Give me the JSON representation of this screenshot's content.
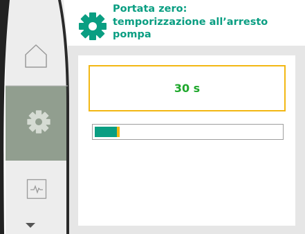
{
  "header": {
    "icon": "gear-icon",
    "title_lines": [
      "Portata zero:",
      "temporizzazione all’arresto",
      "pompa"
    ]
  },
  "value": {
    "display": "30 s",
    "fraction": 0.12
  },
  "sidebar": {
    "items": [
      {
        "icon": "home-icon",
        "selected": false
      },
      {
        "icon": "gear-icon",
        "selected": true
      },
      {
        "icon": "diagnostics-icon",
        "selected": false
      }
    ],
    "more_indicator": "chevron-down-icon"
  },
  "colors": {
    "accent_green": "#0a9e82",
    "value_green": "#1fa82c",
    "focus_yellow": "#f2b713",
    "bezel": "#222222",
    "sidebar_bg": "#eeeeee",
    "sidebar_selected": "#909d8e",
    "panel_grey": "#e6e6e6"
  }
}
